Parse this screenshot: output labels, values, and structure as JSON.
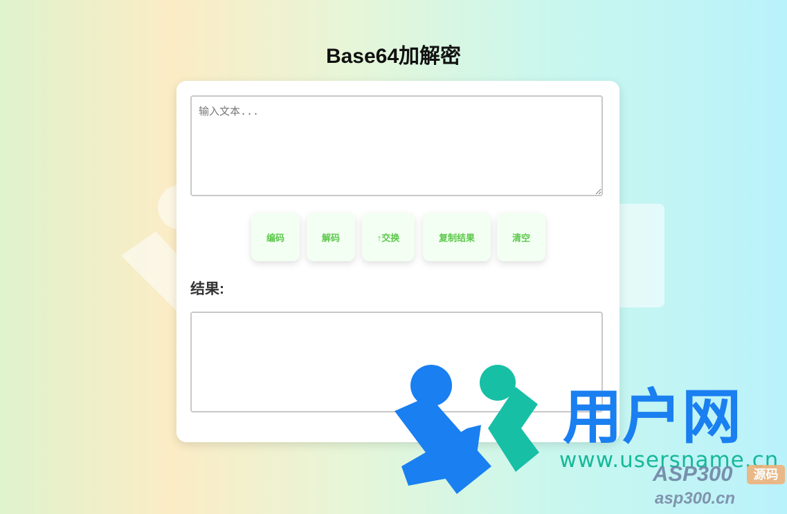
{
  "page": {
    "title": "Base64加解密"
  },
  "input": {
    "placeholder": "输入文本...",
    "value": ""
  },
  "buttons": {
    "encode": "编码",
    "decode": "解码",
    "swap": "↑交换",
    "copy": "复制结果",
    "clear": "清空"
  },
  "result": {
    "label": "结果:",
    "value": ""
  },
  "watermark": {
    "brand": "用户网",
    "url": "www.usersname.cn",
    "asp_brand": "ASP300",
    "asp_badge": "源码",
    "asp_domain": "asp300.cn"
  },
  "colors": {
    "button_text": "#5cc84b",
    "button_bg": "#f2fff2",
    "logo_blue": "#1a7ff0",
    "logo_teal": "#17bfa5"
  }
}
